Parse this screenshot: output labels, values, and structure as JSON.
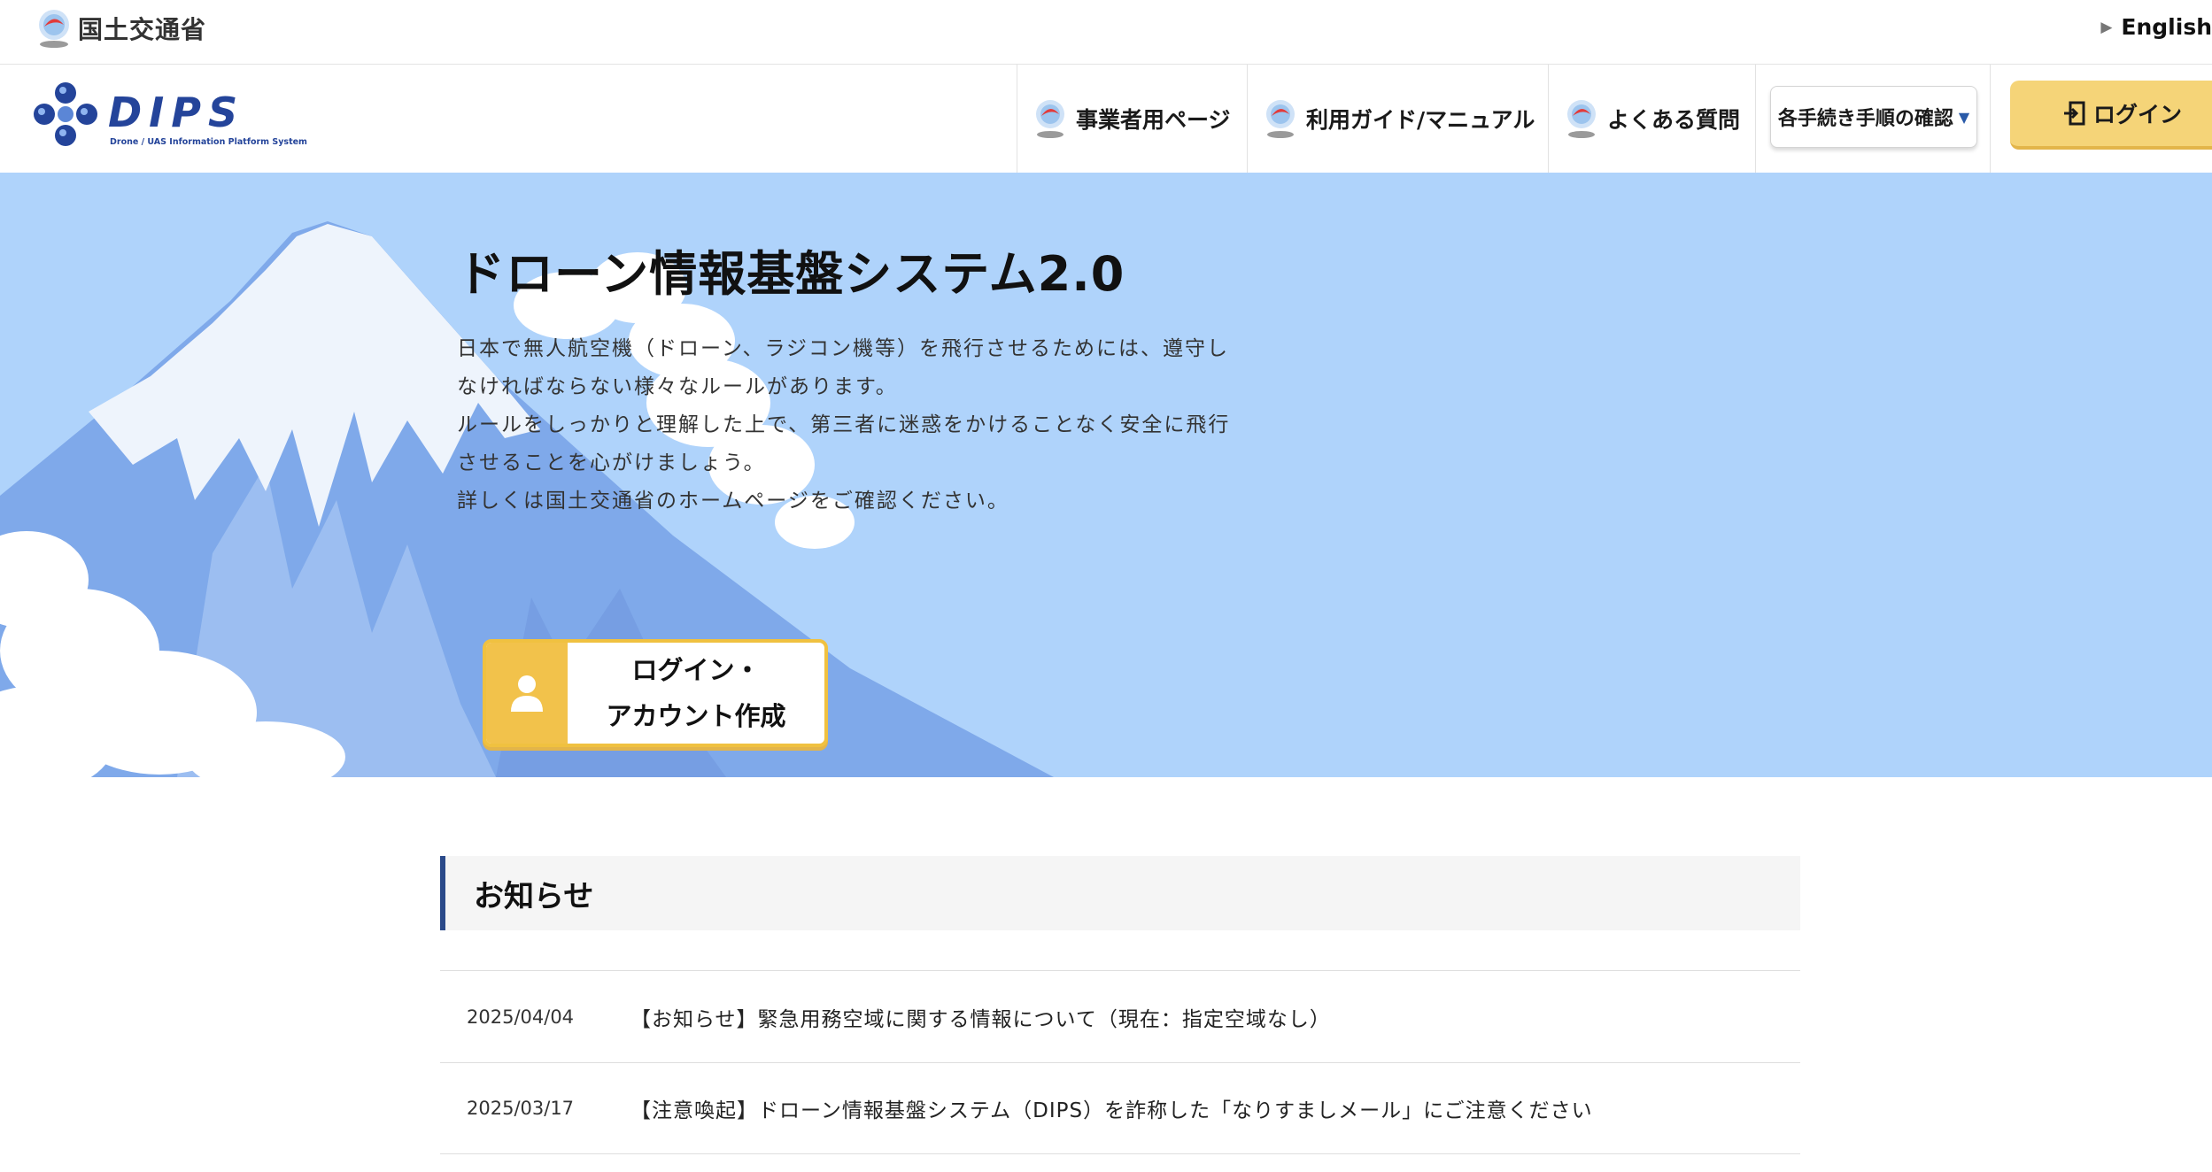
{
  "topbar": {
    "ministry_name": "国土交通省",
    "english_label": "English"
  },
  "header": {
    "logo_text": "DIPS",
    "logo_subtitle": "Drone / UAS Information Platform System",
    "nav": [
      {
        "label": "事業者用ページ",
        "icon": "mlit-emblem-icon"
      },
      {
        "label": "利用ガイド/マニュアル",
        "icon": "mlit-emblem-icon"
      },
      {
        "label": "よくある質問",
        "icon": "mlit-emblem-icon"
      }
    ],
    "procedure_select": "各手続き手順の確認",
    "login_label": "ログイン"
  },
  "hero": {
    "title": "ドローン情報基盤システム2.0",
    "lines": [
      "日本で無人航空機（ドローン、ラジコン機等）を飛行させるためには、遵守し",
      "なければならない様々なルールがあります。",
      "ルールをしっかりと理解した上で、第三者に迷惑をかけることなく安全に飛行",
      "させることを心がけましょう。",
      "詳しくは国土交通省のホームページをご確認ください。"
    ],
    "cta_line1": "ログイン・",
    "cta_line2": "アカウント作成"
  },
  "news": {
    "heading": "お知らせ",
    "items": [
      {
        "date": "2025/04/04",
        "title": "【お知らせ】緊急用務空域に関する情報について（現在：指定空域なし）"
      },
      {
        "date": "2025/03/17",
        "title": "【注意喚起】ドローン情報基盤システム（DIPS）を詐称した「なりすましメール」にご注意ください"
      }
    ]
  },
  "colors": {
    "hero_bg": "#afd3fb",
    "accent_yellow": "#f5d478",
    "brand_navy": "#2b4a8a"
  }
}
